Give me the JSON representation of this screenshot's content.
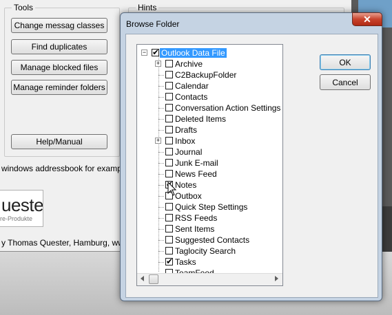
{
  "background_app": {
    "tools_title": "Tools",
    "hints_title": "Hints",
    "buttons": {
      "change_message_classes": "Change messag classes",
      "find_duplicates": "Find duplicates",
      "manage_blocked_files": "Manage blocked files",
      "manage_reminder_folders": "Manage reminder folders",
      "help_manual": "Help/Manual"
    },
    "addressbook_text": "windows addressbook for example O",
    "logo_text": "uester",
    "logo_subtext": "re-Produkte",
    "footer_text": "y Thomas Quester, Hamburg, www.qu"
  },
  "dialog": {
    "title": "Browse Folder",
    "close_symbol": "✕",
    "ok_label": "OK",
    "cancel_label": "Cancel",
    "tree": {
      "root": {
        "label": "Outlook Data File",
        "checked": true,
        "expanded": true,
        "selected": true
      },
      "items": [
        {
          "label": "Archive",
          "checked": false,
          "expandable": true
        },
        {
          "label": "C2BackupFolder",
          "checked": false,
          "expandable": false
        },
        {
          "label": "Calendar",
          "checked": false,
          "expandable": false
        },
        {
          "label": "Contacts",
          "checked": false,
          "expandable": false
        },
        {
          "label": "Conversation Action Settings",
          "checked": false,
          "expandable": false
        },
        {
          "label": "Deleted Items",
          "checked": false,
          "expandable": false
        },
        {
          "label": "Drafts",
          "checked": false,
          "expandable": false
        },
        {
          "label": "Inbox",
          "checked": false,
          "expandable": true
        },
        {
          "label": "Journal",
          "checked": false,
          "expandable": false
        },
        {
          "label": "Junk E-mail",
          "checked": false,
          "expandable": false
        },
        {
          "label": "News Feed",
          "checked": false,
          "expandable": false
        },
        {
          "label": "Notes",
          "checked": true,
          "expandable": false
        },
        {
          "label": "Outbox",
          "checked": false,
          "expandable": false
        },
        {
          "label": "Quick Step Settings",
          "checked": false,
          "expandable": false
        },
        {
          "label": "RSS Feeds",
          "checked": false,
          "expandable": false
        },
        {
          "label": "Sent Items",
          "checked": false,
          "expandable": false
        },
        {
          "label": "Suggested Contacts",
          "checked": false,
          "expandable": false
        },
        {
          "label": "Taglocity Search",
          "checked": false,
          "expandable": false
        },
        {
          "label": "Tasks",
          "checked": true,
          "expandable": false
        },
        {
          "label": "TeamFeed",
          "checked": false,
          "expandable": false
        }
      ]
    }
  },
  "colors": {
    "selection": "#3399ff",
    "dialog_frame": "#c5d3e3",
    "close_button": "#c8432c"
  }
}
